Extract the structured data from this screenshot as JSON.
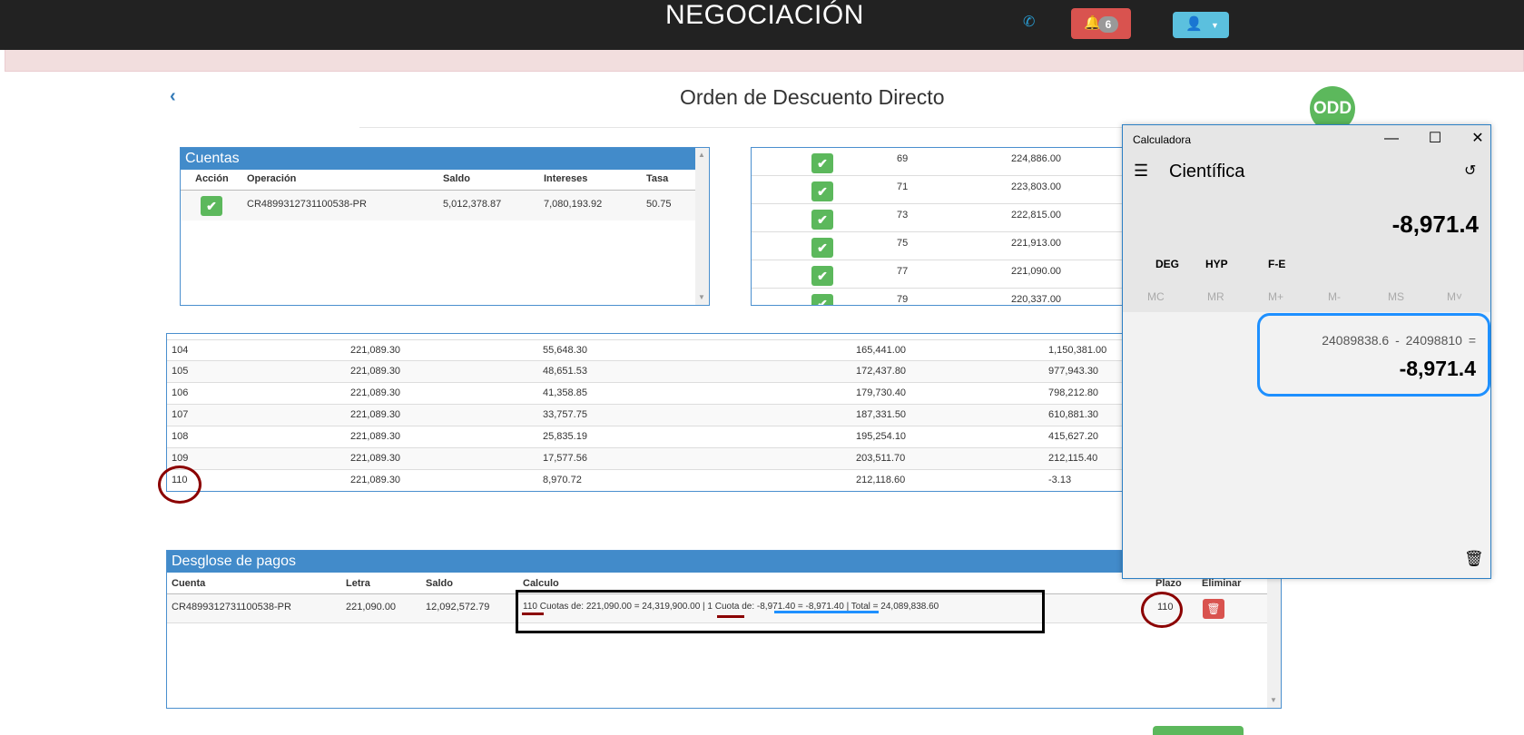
{
  "header": {
    "title": "NEGOCIACIÓN",
    "notification_count": "6"
  },
  "page": {
    "title": "Orden de Descuento Directo",
    "odd_badge": "ODD"
  },
  "cuentas": {
    "title": "Cuentas",
    "columns": [
      "Acción",
      "Operación",
      "Saldo",
      "Intereses",
      "Tasa"
    ],
    "rows": [
      {
        "operacion": "CR4899312731100538-PR",
        "saldo": "5,012,378.87",
        "intereses": "7,080,193.92",
        "tasa": "50.75"
      }
    ]
  },
  "payments_mini": [
    {
      "n": "69",
      "amount": "224,886.00"
    },
    {
      "n": "71",
      "amount": "223,803.00"
    },
    {
      "n": "73",
      "amount": "222,815.00"
    },
    {
      "n": "75",
      "amount": "221,913.00"
    },
    {
      "n": "77",
      "amount": "221,090.00"
    },
    {
      "n": "79",
      "amount": "220,337.00"
    }
  ],
  "amortization": [
    {
      "n": "104",
      "cuota": "221,089.30",
      "interes": "55,648.30",
      "capital": "165,441.00",
      "saldo": "1,150,381.00"
    },
    {
      "n": "105",
      "cuota": "221,089.30",
      "interes": "48,651.53",
      "capital": "172,437.80",
      "saldo": "977,943.30"
    },
    {
      "n": "106",
      "cuota": "221,089.30",
      "interes": "41,358.85",
      "capital": "179,730.40",
      "saldo": "798,212.80"
    },
    {
      "n": "107",
      "cuota": "221,089.30",
      "interes": "33,757.75",
      "capital": "187,331.50",
      "saldo": "610,881.30"
    },
    {
      "n": "108",
      "cuota": "221,089.30",
      "interes": "25,835.19",
      "capital": "195,254.10",
      "saldo": "415,627.20"
    },
    {
      "n": "109",
      "cuota": "221,089.30",
      "interes": "17,577.56",
      "capital": "203,511.70",
      "saldo": "212,115.40"
    },
    {
      "n": "110",
      "cuota": "221,089.30",
      "interes": "8,970.72",
      "capital": "212,118.60",
      "saldo": "-3.13"
    }
  ],
  "desglose": {
    "title": "Desglose de pagos",
    "columns": [
      "Cuenta",
      "Letra",
      "Saldo",
      "Calculo",
      "Plazo",
      "Eliminar"
    ],
    "row": {
      "cuenta": "CR4899312731100538-PR",
      "letra": "221,090.00",
      "saldo": "12,092,572.79",
      "calculo": "110 Cuotas de: 221,090.00 = 24,319,900.00 | 1 Cuota de: -8,971.40 = -8,971.40 | Total = 24,089,838.60",
      "plazo": "110"
    }
  },
  "calculator": {
    "title": "Calculadora",
    "mode": "Científica",
    "display": "-8,971.4",
    "functions": [
      "DEG",
      "HYP",
      "F-E"
    ],
    "memory": [
      "MC",
      "MR",
      "M+",
      "M-",
      "MS",
      "M˅"
    ],
    "history_expression": "24089838.6 - 24098810 =",
    "history_result": "-8,971.4"
  }
}
